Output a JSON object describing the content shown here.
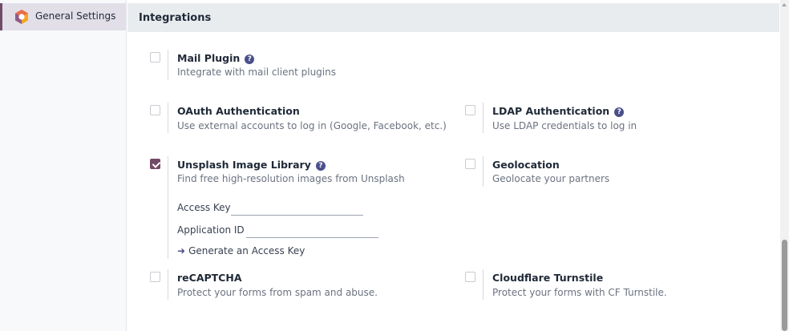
{
  "sidebar": {
    "items": [
      {
        "label": "General Settings",
        "icon": "app-logo-icon",
        "active": true
      }
    ]
  },
  "section": {
    "title": "Integrations"
  },
  "settings": {
    "mail_plugin": {
      "title": "Mail Plugin",
      "description": "Integrate with mail client plugins",
      "checked": false,
      "help": "?"
    },
    "oauth": {
      "title": "OAuth Authentication",
      "description": "Use external accounts to log in (Google, Facebook, etc.)",
      "checked": false
    },
    "ldap": {
      "title": "LDAP Authentication",
      "description": "Use LDAP credentials to log in",
      "checked": false,
      "help": "?"
    },
    "unsplash": {
      "title": "Unsplash Image Library",
      "description": "Find free high-resolution images from Unsplash",
      "checked": true,
      "help": "?",
      "access_key_label": "Access Key",
      "access_key_value": "",
      "application_id_label": "Application ID",
      "application_id_value": "",
      "generate_link": "Generate an Access Key"
    },
    "geolocation": {
      "title": "Geolocation",
      "description": "Geolocate your partners",
      "checked": false
    },
    "recaptcha": {
      "title": "reCAPTCHA",
      "description": "Protect your forms from spam and abuse.",
      "checked": false
    },
    "turnstile": {
      "title": "Cloudflare Turnstile",
      "description": "Protect your forms with CF Turnstile.",
      "checked": false
    }
  },
  "colors": {
    "accent": "#714b67",
    "help_icon": "#4b4f8a",
    "header_bg": "#e9ecef",
    "sidebar_active_bg": "#e2dfe9"
  }
}
